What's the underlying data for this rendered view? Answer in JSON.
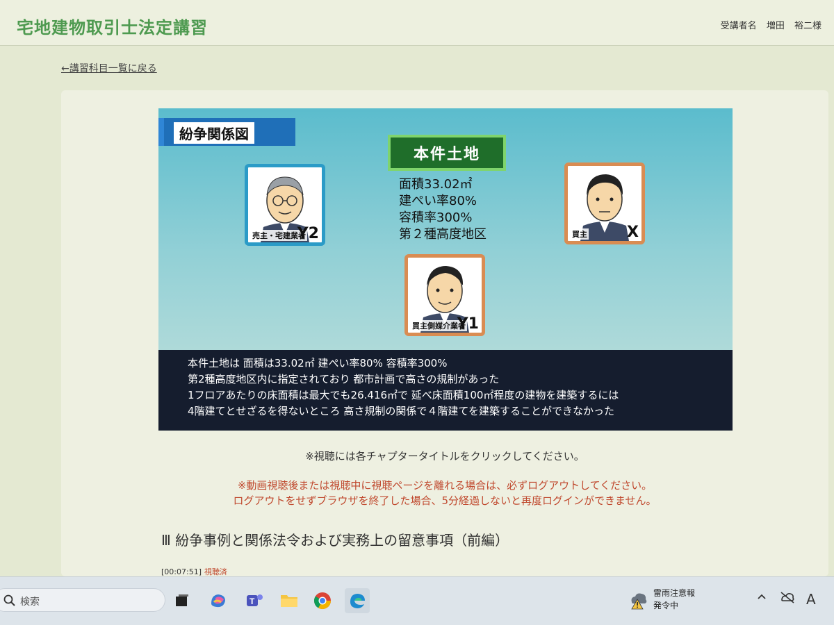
{
  "header": {
    "site_title": "宅地建物取引士法定講習",
    "user_label": "受講者名",
    "user_surname": "増田",
    "user_given": "裕二様"
  },
  "nav": {
    "back_link": "←講習科目一覧に戻る"
  },
  "slide": {
    "heading": "紛争関係図",
    "land_title": "本件土地",
    "land_details": [
      "面積33.02㎡",
      "建ぺい率80%",
      "容積率300%",
      "第２種高度地区"
    ],
    "people": {
      "y2": {
        "caption": "売主・宅建業者",
        "code": "Y2"
      },
      "x": {
        "caption": "買主",
        "code": "X"
      },
      "y1": {
        "caption": "買主側媒介業者",
        "code": "Y1"
      }
    },
    "subtitles": [
      "本件土地は 面積は33.02㎡ 建ぺい率80% 容積率300%",
      "第2種高度地区内に指定されており 都市計画で高さの規制があった",
      "1フロアあたりの床面積は最大でも26.416㎡で 延べ床面積100㎡程度の建物を建築するには",
      "4階建てとせざるを得ないところ 高さ規制の関係で４階建てを建築することができなかった"
    ]
  },
  "notes": {
    "instruction": "※視聴には各チャプタータイトルをクリックしてください。",
    "warning_line1": "※動画視聴後または視聴中に視聴ページを離れる場合は、必ずログアウトしてください。",
    "warning_line2": "ログアウトをせずブラウザを終了した場合、5分経過しないと再度ログインができません。"
  },
  "chapter": {
    "title": "Ⅲ 紛争事例と関係法令および実務上の留意事項（前編）",
    "duration": "[00:07:51]",
    "status": "視聴済"
  },
  "taskbar": {
    "search_placeholder": "検索",
    "weather_line1": "雷雨注意報",
    "weather_line2": "発令中",
    "ime_indicator": "A"
  },
  "colors": {
    "site_title": "#4e9a50",
    "warning_text": "#c0492e",
    "slide_heading_bg": "#1f6fb8",
    "land_box_bg": "#1f6e2a",
    "subtitle_band_bg": "#151d2e"
  }
}
